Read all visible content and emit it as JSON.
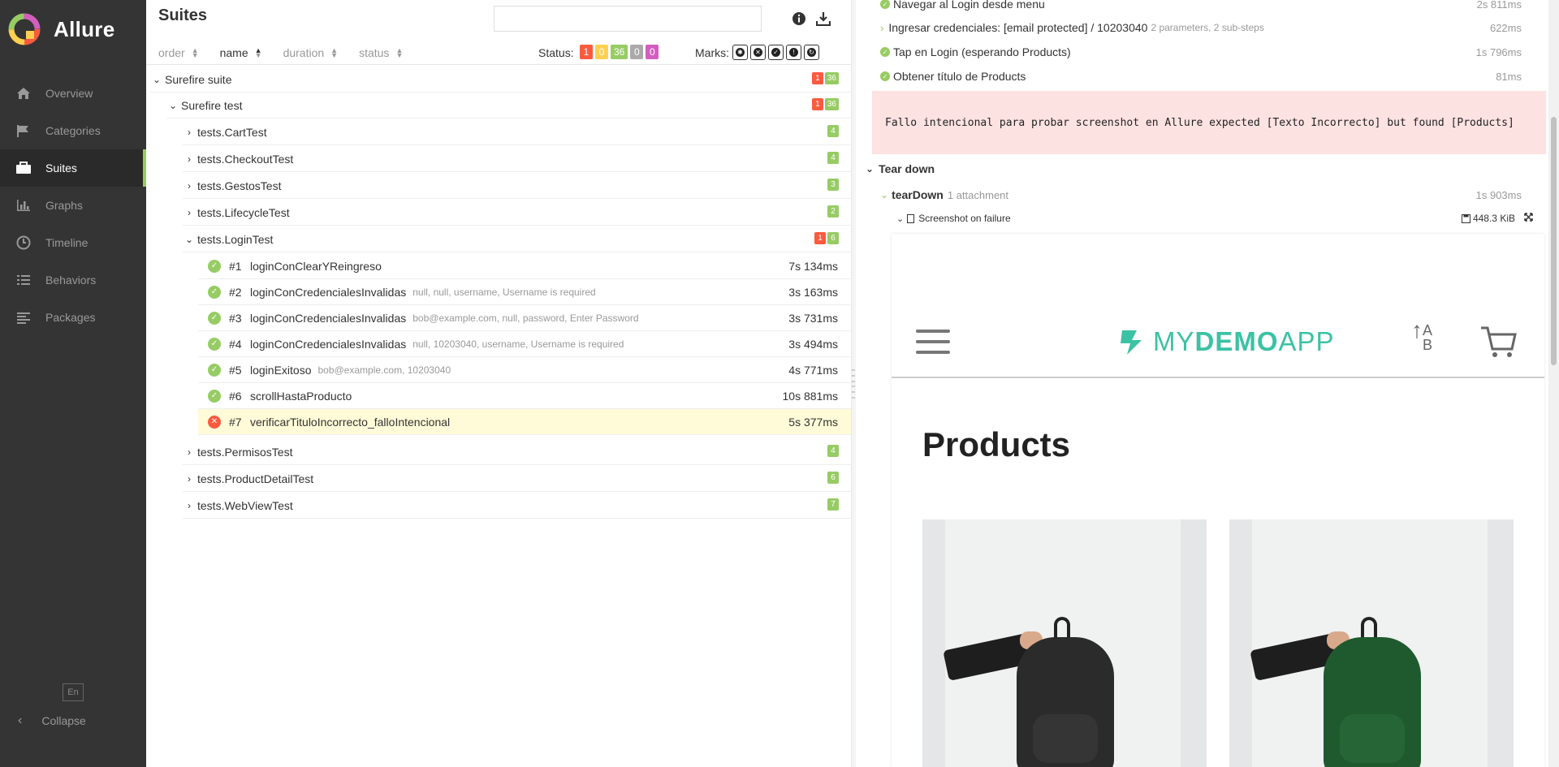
{
  "app": {
    "name": "Allure"
  },
  "sidebar": {
    "items": [
      {
        "label": "Overview",
        "icon": "home-icon"
      },
      {
        "label": "Categories",
        "icon": "flag-icon"
      },
      {
        "label": "Suites",
        "icon": "briefcase-icon"
      },
      {
        "label": "Graphs",
        "icon": "bar-chart-icon"
      },
      {
        "label": "Timeline",
        "icon": "clock-icon"
      },
      {
        "label": "Behaviors",
        "icon": "list-icon"
      },
      {
        "label": "Packages",
        "icon": "align-left-icon"
      }
    ],
    "active": "Suites",
    "lang": "En",
    "collapse_label": "Collapse"
  },
  "suites": {
    "title": "Suites",
    "search_value": "",
    "sort": [
      "order",
      "name",
      "duration",
      "status"
    ],
    "sort_selected": "name",
    "status_label": "Status:",
    "status_counts": {
      "failed": "1",
      "broken": "0",
      "passed": "36",
      "skipped": "0",
      "unknown": "0"
    },
    "marks_label": "Marks:",
    "marks": [
      "flaky-mark-icon",
      "new-failed-mark-icon",
      "new-passed-mark-icon",
      "new-broken-mark-icon",
      "retries-mark-icon"
    ]
  },
  "tree": {
    "root": {
      "name": "Surefire suite",
      "failed": "1",
      "passed": "36"
    },
    "child": {
      "name": "Surefire test",
      "failed": "1",
      "passed": "36"
    },
    "groups_before": [
      {
        "name": "tests.CartTest",
        "passed": "4"
      },
      {
        "name": "tests.CheckoutTest",
        "passed": "4"
      },
      {
        "name": "tests.GestosTest",
        "passed": "3"
      },
      {
        "name": "tests.LifecycleTest",
        "passed": "2"
      }
    ],
    "open_group": {
      "name": "tests.LoginTest",
      "failed": "1",
      "passed": "6"
    },
    "tests": [
      {
        "num": "#1",
        "name": "loginConClearYReingreso",
        "params": "",
        "duration": "7s 134ms",
        "status": "passed"
      },
      {
        "num": "#2",
        "name": "loginConCredencialesInvalidas",
        "params": "null, null, username, Username is required",
        "duration": "3s 163ms",
        "status": "passed"
      },
      {
        "num": "#3",
        "name": "loginConCredencialesInvalidas",
        "params": "bob@example.com, null, password, Enter Password",
        "duration": "3s 731ms",
        "status": "passed"
      },
      {
        "num": "#4",
        "name": "loginConCredencialesInvalidas",
        "params": "null, 10203040, username, Username is required",
        "duration": "3s 494ms",
        "status": "passed"
      },
      {
        "num": "#5",
        "name": "loginExitoso",
        "params": "bob@example.com, 10203040",
        "duration": "4s 771ms",
        "status": "passed"
      },
      {
        "num": "#6",
        "name": "scrollHastaProducto",
        "params": "",
        "duration": "10s 881ms",
        "status": "passed"
      },
      {
        "num": "#7",
        "name": "verificarTituloIncorrecto_falloIntencional",
        "params": "",
        "duration": "5s 377ms",
        "status": "failed"
      }
    ],
    "groups_after": [
      {
        "name": "tests.PermisosTest",
        "passed": "4"
      },
      {
        "name": "tests.ProductDetailTest",
        "passed": "6"
      },
      {
        "name": "tests.WebViewTest",
        "passed": "7"
      }
    ]
  },
  "detail": {
    "steps": [
      {
        "name": "Navegar al Login desde menu",
        "sub": "",
        "duration": "2s 811ms"
      },
      {
        "name": "Ingresar credenciales: [email protected] / 10203040",
        "sub": "2 parameters, 2 sub-steps",
        "duration": "622ms"
      },
      {
        "name": "Tap en Login (esperando Products)",
        "sub": "",
        "duration": "1s 796ms"
      },
      {
        "name": "Obtener título de Products",
        "sub": "",
        "duration": "81ms"
      }
    ],
    "error": "Fallo intencional para probar screenshot en Allure expected [Texto Incorrecto] but found [Products]",
    "teardown_title": "Tear down",
    "teardown": {
      "name": "tearDown",
      "sub": "1 attachment",
      "duration": "1s 903ms"
    },
    "attachment": {
      "name": "Screenshot on failure",
      "size": "448.3 KiB"
    },
    "screenshot": {
      "logo_light": "MY",
      "logo_bold": "DEMO",
      "logo_end": "APP",
      "sort_glyph_top": "A",
      "sort_glyph_bottom": "B",
      "title": "Products",
      "colors": {
        "accent": "#3bc2a4",
        "bag1": "#2b2b2b",
        "bag2": "#1f5a2e"
      }
    }
  },
  "colors": {
    "sidebar_bg": "#343434",
    "failed": "#fd5a3e",
    "broken": "#ffd050",
    "passed": "#97cc64",
    "skipped": "#aaaaaa",
    "unknown": "#d35ebe",
    "selected_row": "#fffbd8",
    "error_bg": "#fde2e2"
  }
}
